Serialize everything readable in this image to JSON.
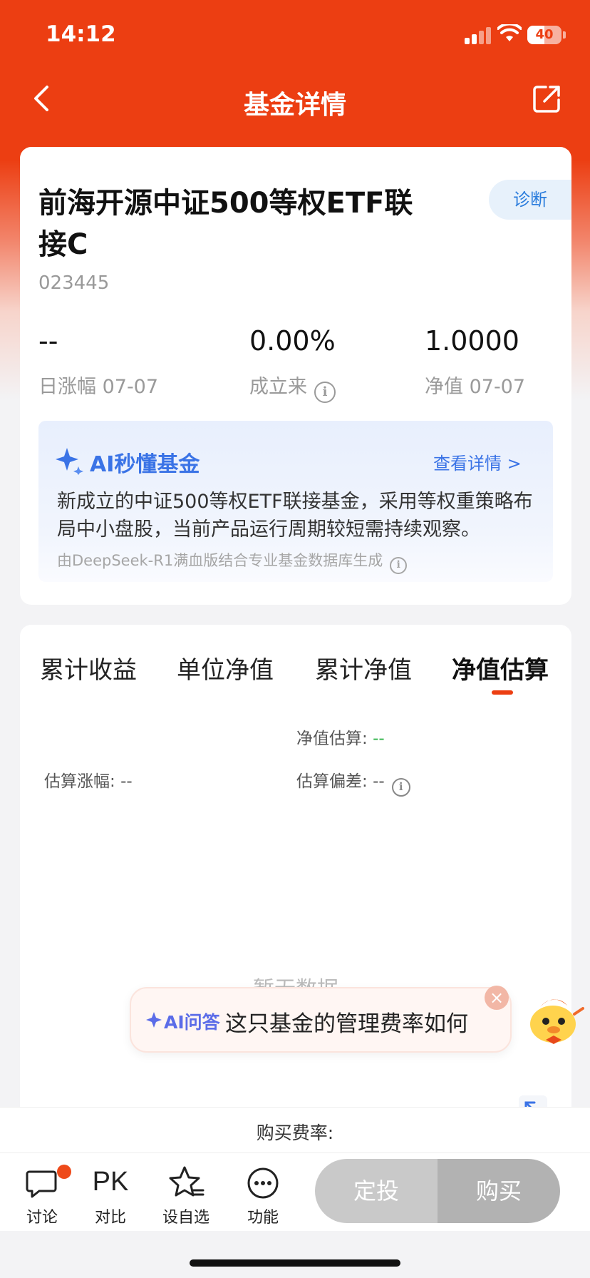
{
  "status_bar": {
    "time": "14:12",
    "battery": "40"
  },
  "nav": {
    "title": "基金详情",
    "back_icon": "chevron-left-icon",
    "share_icon": "share-icon"
  },
  "fund": {
    "name": "前海开源中证500等权ETF联接C",
    "code": "023445",
    "diagnose_label": "诊断",
    "stats": [
      {
        "value": "--",
        "label": "日涨幅 07-07"
      },
      {
        "value": "0.00%",
        "label": "成立来"
      },
      {
        "value": "1.0000",
        "label": "净值 07-07"
      }
    ]
  },
  "ai_summary": {
    "title": "AI秒懂基金",
    "more": "查看详情 >",
    "text": "新成立的中证500等权ETF联接基金，采用等权重策略布局中小盘股，当前产品运行周期较短需持续观察。",
    "source": "由DeepSeek-R1满血版结合专业基金数据库生成"
  },
  "chart_tabs": {
    "tabs": [
      "累计收益",
      "单位净值",
      "累计净值",
      "净值估算"
    ],
    "active_index": 3,
    "estimate_label": "净值估算:",
    "estimate_value": "--",
    "change_label": "估算涨幅:",
    "change_value": "--",
    "deviation_label": "估算偏差:",
    "deviation_value": "--",
    "no_data": "暂无数据"
  },
  "ai_bubble": {
    "tag": "AI问答",
    "question": "这只基金的管理费率如何"
  },
  "fee": {
    "label": "购买费率:"
  },
  "bottom_nav": {
    "items": [
      {
        "label": "讨论",
        "icon": "chat-icon"
      },
      {
        "label": "对比",
        "icon_text": "PK"
      },
      {
        "label": "设自选",
        "icon": "star-add-icon"
      },
      {
        "label": "功能",
        "icon": "more-icon"
      }
    ],
    "plan_label": "定投",
    "buy_label": "购买"
  },
  "colors": {
    "brand": "#ec3e12",
    "ai_blue": "#3a73e6",
    "diagnose_blue": "#2a7cdc",
    "estimate_green": "#2fb34a"
  }
}
